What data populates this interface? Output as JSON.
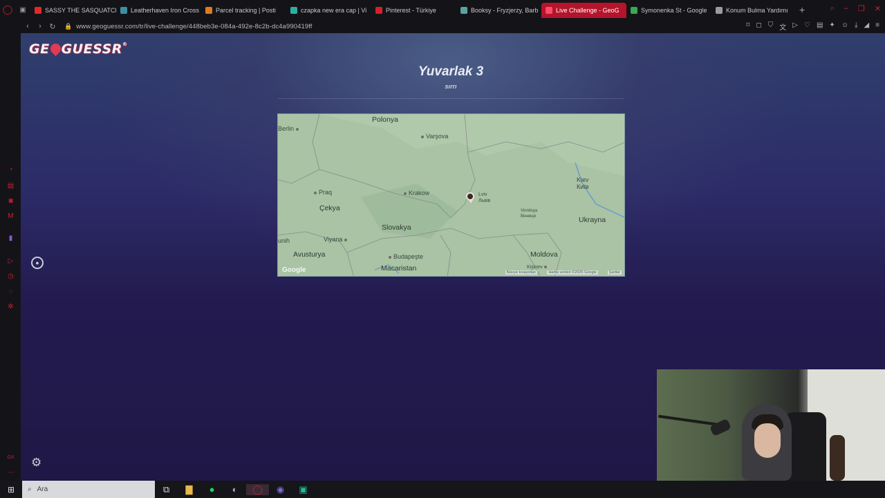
{
  "browser": {
    "tabs": [
      {
        "label": "SASSY THE SASQUATCH",
        "color": "#e02a2a",
        "active": false
      },
      {
        "label": "Leatherhaven Iron Cross",
        "color": "#3d8fa3",
        "active": false
      },
      {
        "label": "Parcel tracking | Posti",
        "color": "#e07a20",
        "active": false
      },
      {
        "label": "czapka new era cap | Vi",
        "color": "#2bb0a0",
        "active": false
      },
      {
        "label": "Pinterest - Türkiye",
        "color": "#d6202a",
        "active": false
      },
      {
        "label": "Booksy - Fryzjerzy, Barb",
        "color": "#5aa3a0",
        "active": false
      },
      {
        "label": "Live Challenge - GeoG",
        "color": "#ff4a6a",
        "active": true
      },
      {
        "label": "Symonenka St - Google",
        "color": "#38a852",
        "active": false
      },
      {
        "label": "Konum Bulma Yardımı",
        "color": "#9a9aa0",
        "active": false
      }
    ],
    "url": "www.geoguessr.com/tr/live-challenge/448beb3e-084a-492e-8c2b-dc4a990419ff"
  },
  "page": {
    "logo_text_a": "GE",
    "logo_text_b": "GUESSR",
    "round_title": "Yuvarlak 3",
    "round_subtitle": "sırrı"
  },
  "map": {
    "labels": {
      "polonya": "Polonya",
      "berlin": "Berlin",
      "varsova": "Varşova",
      "praq": "Praq",
      "krakow": "Krakow",
      "lviv": "Lviv\nЛьвів",
      "cekya": "Çekya",
      "slovakya": "Slovakya",
      "kiev": "Kiev\nКиїв",
      "vinnitsya": "Vinnitsya\nВінниця",
      "ukrayna": "Ukrayna",
      "unih": "unih",
      "viyana": "Viyana",
      "avusturya": "Avusturya",
      "budapeste": "Budapeşte",
      "moldova": "Moldova",
      "macaristan": "Macaristan",
      "kisinev": "Kişinev"
    },
    "google": "Google",
    "attribution": [
      "Klavye kısayolları",
      "Harita verileri ©2025 Google",
      "Şartlar"
    ]
  },
  "taskbar": {
    "search_placeholder": "Ara"
  }
}
